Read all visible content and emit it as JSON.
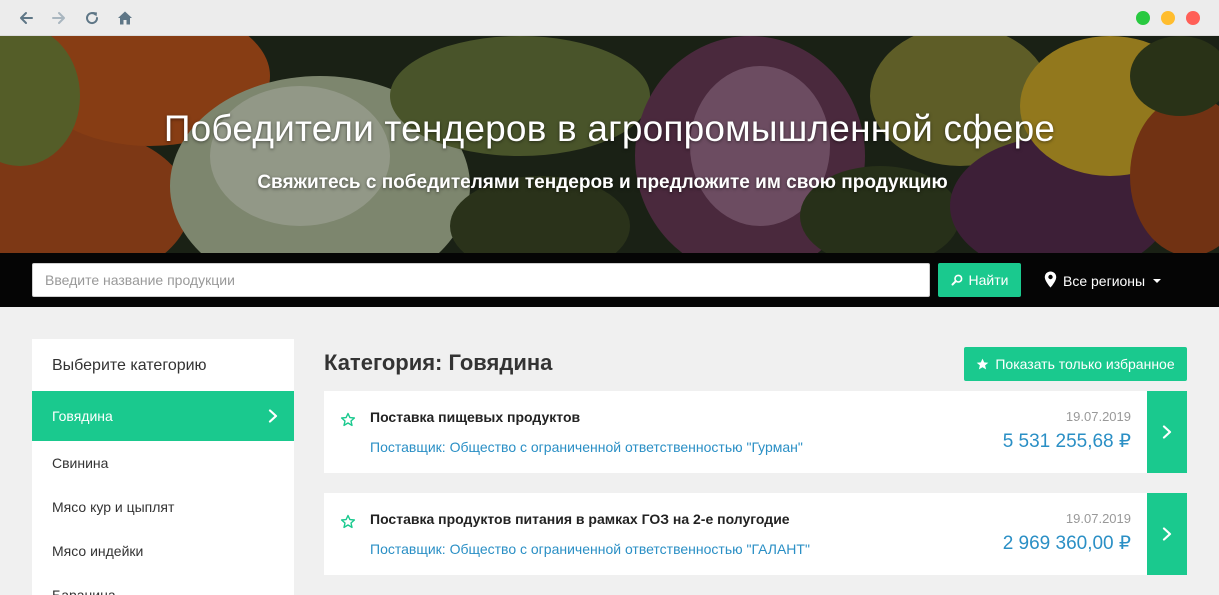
{
  "hero": {
    "title": "Победители тендеров в агропромышленной сфере",
    "subtitle": "Свяжитесь с победителями тендеров и предложите им свою продукцию"
  },
  "search": {
    "placeholder": "Введите название продукции",
    "value": "",
    "button_label": "Найти",
    "region_label": "Все регионы"
  },
  "sidebar": {
    "title": "Выберите категорию",
    "items": [
      {
        "label": "Говядина",
        "active": true
      },
      {
        "label": "Свинина",
        "active": false
      },
      {
        "label": "Мясо кур и цыплят",
        "active": false
      },
      {
        "label": "Мясо индейки",
        "active": false
      },
      {
        "label": "Баранина",
        "active": false
      }
    ]
  },
  "main": {
    "heading": "Категория: Говядина",
    "favorites_label": "Показать только избранное",
    "tenders": [
      {
        "title": "Поставка пищевых продуктов",
        "supplier": "Поставщик: Общество с ограниченной ответственностью \"Гурман\"",
        "date": "19.07.2019",
        "price": "5 531 255,68 ₽"
      },
      {
        "title": "Поставка продуктов питания в рамках ГОЗ на 2-е полугодие",
        "supplier": "Поставщик: Общество с ограниченной ответственностью \"ГАЛАНТ\"",
        "date": "19.07.2019",
        "price": "2 969 360,00 ₽"
      }
    ]
  },
  "colors": {
    "accent": "#1ac98e",
    "link": "#2a8fc5",
    "dot_green": "#28c940",
    "dot_yellow": "#ffbd2e",
    "dot_red": "#ff5f57"
  },
  "icons": {
    "back": "arrow-left-icon",
    "forward": "arrow-right-icon",
    "reload": "reload-icon",
    "home": "home-icon",
    "search": "magnifier-icon",
    "region": "map-pin-icon",
    "favorite": "star-icon",
    "open": "chevron-right-icon"
  }
}
